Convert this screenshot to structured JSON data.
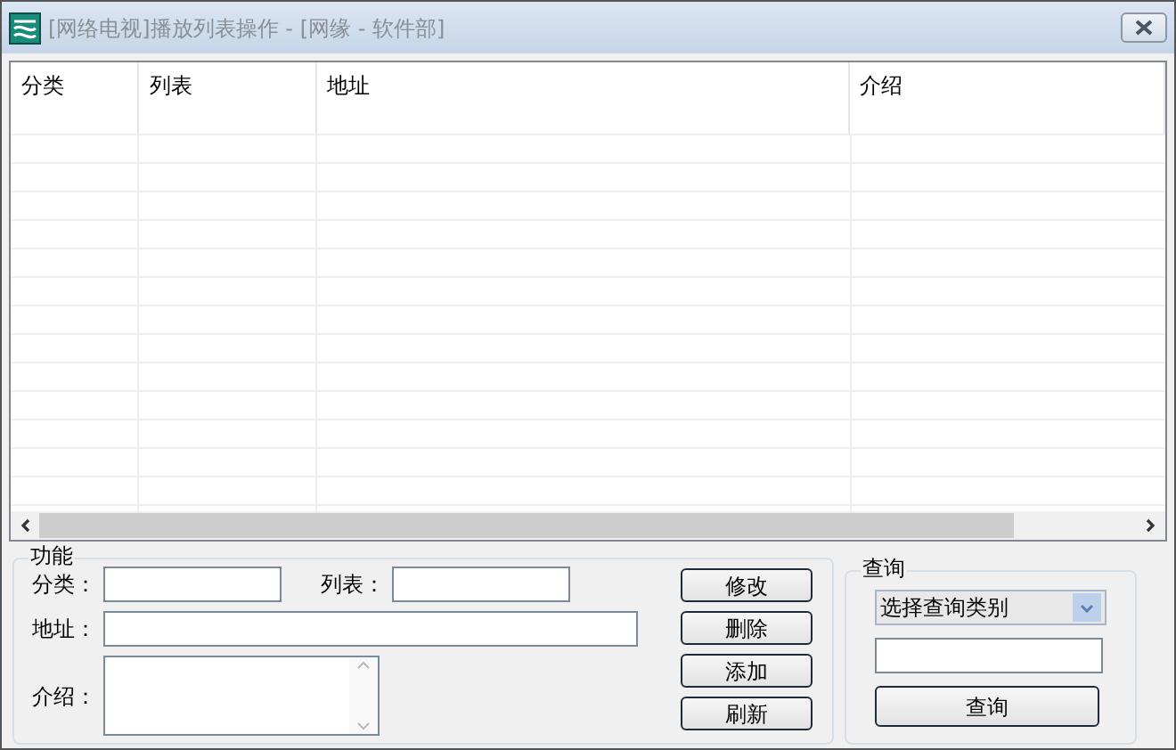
{
  "window": {
    "title": "[网络电视]播放列表操作 - [网缘 - 软件部]",
    "active": false
  },
  "table": {
    "columns": [
      {
        "label": "分类"
      },
      {
        "label": "列表"
      },
      {
        "label": "地址"
      },
      {
        "label": "介绍"
      }
    ]
  },
  "function_group": {
    "title": "功能",
    "fields": [
      {
        "label": "分类：",
        "kind": "short"
      },
      {
        "label": "列表：",
        "kind": "short"
      },
      {
        "label": "地址：",
        "kind": "long"
      },
      {
        "label": "介绍：",
        "kind": "multiline"
      }
    ],
    "buttons": [
      "修改",
      "删除",
      "添加",
      "刷新"
    ]
  },
  "query_group": {
    "title": "查询",
    "select": "选择查询类别",
    "button": "查询"
  }
}
